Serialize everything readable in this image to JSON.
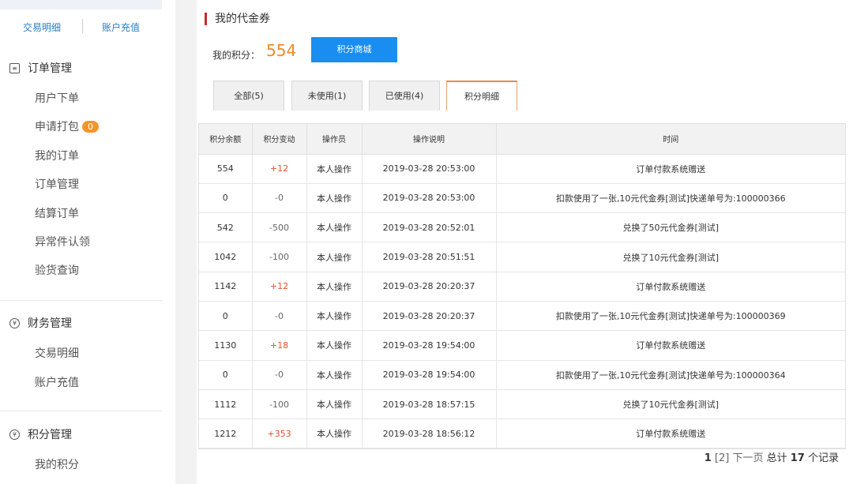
{
  "sidebar": {
    "quick_links": [
      "交易明细",
      "账户充值"
    ],
    "groups": [
      {
        "title": "订单管理",
        "items": [
          {
            "label": "用户下单"
          },
          {
            "label": "申请打包",
            "badge": "0"
          },
          {
            "label": "我的订单"
          },
          {
            "label": "订单管理"
          },
          {
            "label": "结算订单"
          },
          {
            "label": "异常件认领"
          },
          {
            "label": "验货查询"
          }
        ]
      },
      {
        "title": "财务管理",
        "items": [
          {
            "label": "交易明细"
          },
          {
            "label": "账户充值"
          }
        ]
      },
      {
        "title": "积分管理",
        "items": [
          {
            "label": "我的积分"
          }
        ]
      }
    ]
  },
  "main": {
    "title": "我的代金券",
    "points_label": "我的积分：",
    "points_value": "554",
    "mall_button": "积分商城",
    "tabs": [
      "全部(5)",
      "未使用(1)",
      "已使用(4)",
      "积分明细"
    ],
    "active_tab": 3
  },
  "table": {
    "headers": [
      "积分余额",
      "积分变动",
      "操作员",
      "操作说明",
      "时间"
    ],
    "rows": [
      [
        "554",
        "+12",
        "本人操作",
        "2019-03-28 20:53:00",
        "订单付款系统赠送"
      ],
      [
        "0",
        "-0",
        "本人操作",
        "2019-03-28 20:53:00",
        "扣款使用了一张,10元代金券[测试]快递单号为:100000366"
      ],
      [
        "542",
        "-500",
        "本人操作",
        "2019-03-28 20:52:01",
        "兑换了50元代金券[测试]"
      ],
      [
        "1042",
        "-100",
        "本人操作",
        "2019-03-28 20:51:51",
        "兑换了10元代金券[测试]"
      ],
      [
        "1142",
        "+12",
        "本人操作",
        "2019-03-28 20:20:37",
        "订单付款系统赠送"
      ],
      [
        "0",
        "-0",
        "本人操作",
        "2019-03-28 20:20:37",
        "扣款使用了一张,10元代金券[测试]快递单号为:100000369"
      ],
      [
        "1130",
        "+18",
        "本人操作",
        "2019-03-28 19:54:00",
        "订单付款系统赠送"
      ],
      [
        "0",
        "-0",
        "本人操作",
        "2019-03-28 19:54:00",
        "扣款使用了一张,10元代金券[测试]快递单号为:100000364"
      ],
      [
        "1112",
        "-100",
        "本人操作",
        "2019-03-28 18:57:15",
        "兑换了10元代金券[测试]"
      ],
      [
        "1212",
        "+353",
        "本人操作",
        "2019-03-28 18:56:12",
        "订单付款系统赠送"
      ]
    ]
  },
  "pager": {
    "current": "1",
    "other": "[2]",
    "next": "下一页",
    "total_prefix": "总计",
    "total": "17",
    "total_suffix": "个记录"
  },
  "colors": {
    "accent_blue": "#1a8ef0",
    "points_orange": "#f08a24",
    "positive_red": "#e8502a",
    "title_bar_red": "#c72b2b"
  }
}
